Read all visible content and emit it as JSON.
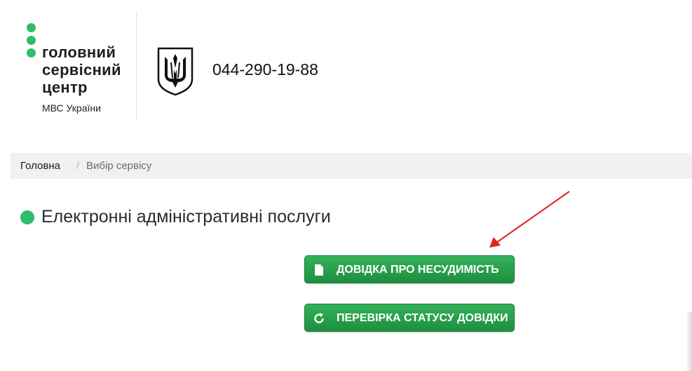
{
  "header": {
    "logo_lines": [
      "головний",
      "сервісний",
      "центр"
    ],
    "logo_sub": "МВС України",
    "phone": "044-290-19-88",
    "emblem_icon": "trident-icon"
  },
  "breadcrumb": {
    "home": "Головна",
    "separator": "/",
    "current": "Вибір сервісу"
  },
  "section": {
    "title": "Електронні адміністративні послуги"
  },
  "buttons": [
    {
      "label": "ДОВІДКА ПРО НЕСУДИМІСТЬ",
      "icon": "document-icon"
    },
    {
      "label": "ПЕРЕВІРКА СТАТУСУ ДОВІДКИ",
      "icon": "refresh-icon"
    }
  ],
  "colors": {
    "brand_green": "#2ebd6b",
    "button_green": "#1e8f3f",
    "annotation_red": "#e02020"
  }
}
